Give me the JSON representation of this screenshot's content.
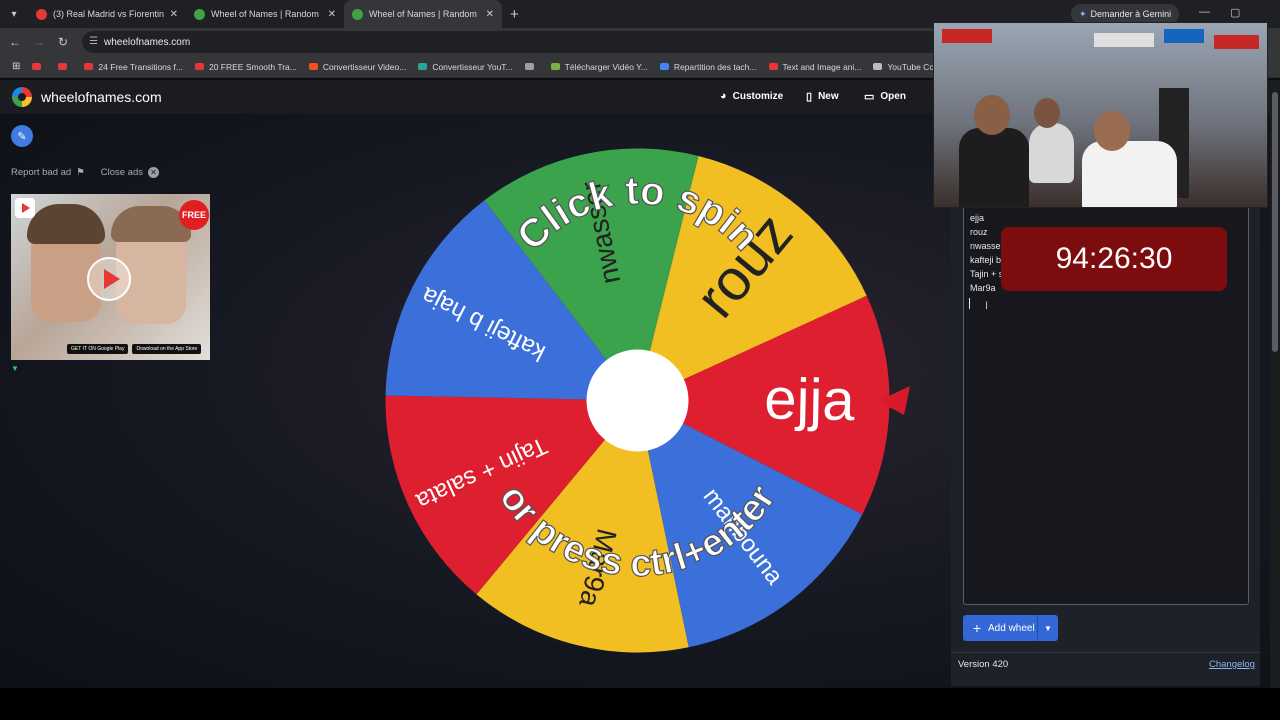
{
  "browser": {
    "tabs": [
      {
        "title": "(3) Real Madrid vs Fiorentina 2-",
        "favicon_color": "#e53935",
        "active": false
      },
      {
        "title": "Wheel of Names | Random nam",
        "favicon_color": "#43a047",
        "active": false
      },
      {
        "title": "Wheel of Names | Random nam",
        "favicon_color": "#43a047",
        "active": true
      }
    ],
    "gemini_label": "Demander à Gemini",
    "url": "wheelofnames.com",
    "bookmarks": [
      {
        "label": "",
        "color": "#e53935"
      },
      {
        "label": "",
        "color": "#e53935"
      },
      {
        "label": "24 Free Transitions f...",
        "color": "#e53935"
      },
      {
        "label": "20 FREE Smooth Tra...",
        "color": "#e53935"
      },
      {
        "label": "Convertisseur Video...",
        "color": "#f4511e"
      },
      {
        "label": "Convertisseur YouT...",
        "color": "#26a69a"
      },
      {
        "label": "",
        "color": "#9e9e9e"
      },
      {
        "label": "Télécharger Vidéo Y...",
        "color": "#7cb342"
      },
      {
        "label": "Repartition des tach...",
        "color": "#4285f4"
      },
      {
        "label": "Text and Image ani...",
        "color": "#e53935"
      },
      {
        "label": "YouTube Converter...",
        "color": "#bdbdbd"
      }
    ]
  },
  "site": {
    "title": "wheelofnames.com",
    "menu": {
      "customize": "Customize",
      "new": "New",
      "open": "Open"
    }
  },
  "ads": {
    "report": "Report bad ad",
    "close": "Close ads",
    "free_badge": "FREE",
    "google_play": "GET IT ON Google Play",
    "app_store": "Download on the App Store"
  },
  "wheel": {
    "segments": [
      {
        "label": "rouz",
        "color": "#f2bf22"
      },
      {
        "label": "ejja",
        "color": "#de1f30"
      },
      {
        "label": "mahbouna",
        "color": "#3b6fd9"
      },
      {
        "label": "Mar9a",
        "color": "#f2bf22"
      },
      {
        "label": "Tajin + salata",
        "color": "#de1f30"
      },
      {
        "label": "kafteji b haja",
        "color": "#3b6fd9"
      },
      {
        "label": "nwasser",
        "color": "#3aa34c"
      }
    ],
    "line1": "Click to spin",
    "line2": "or press ctrl+enter",
    "pointer_color": "#d81b2a"
  },
  "entries": {
    "partial_top": "Mahbouna",
    "items": [
      "ejja",
      "rouz",
      "nwasser",
      "kafteji b",
      "Tajin + s",
      "Mar9a"
    ]
  },
  "timer": "94:26:30",
  "add_wheel": "Add wheel",
  "version": "Version 420",
  "changelog": "Changelog"
}
